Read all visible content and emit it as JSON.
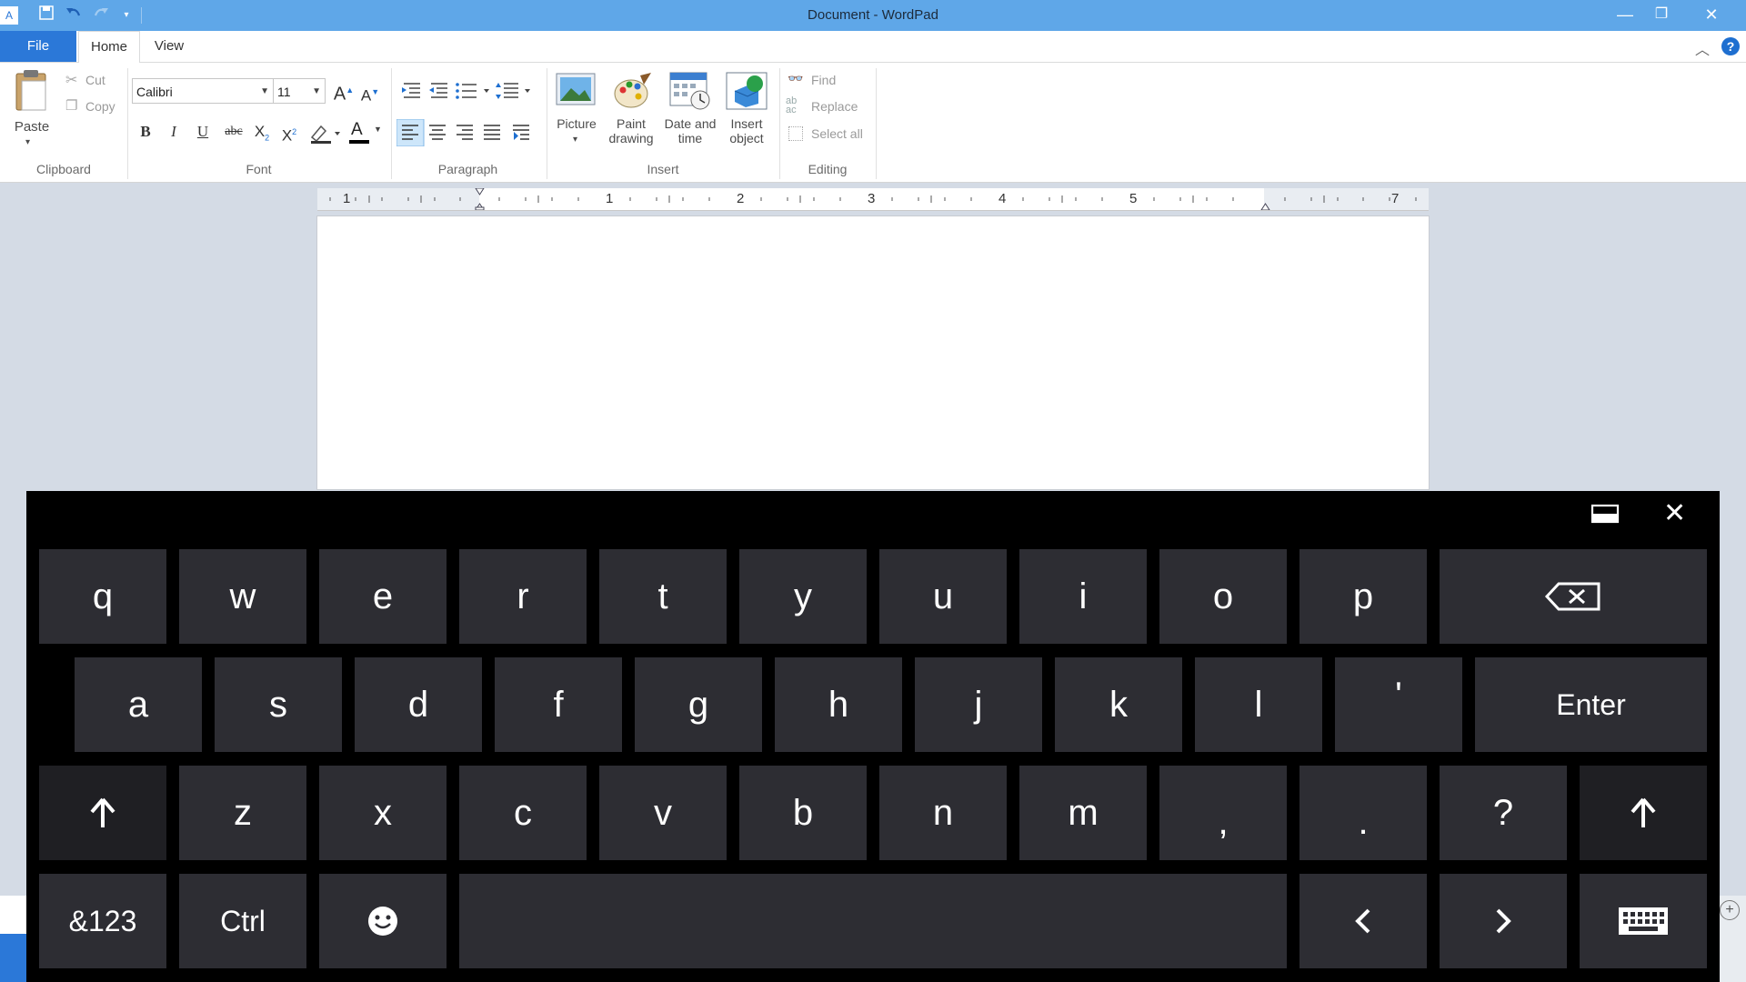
{
  "window": {
    "title": "Document - WordPad",
    "controls": {
      "minimize": "—",
      "restore": "❐",
      "close": "✕"
    }
  },
  "tabs": [
    "File",
    "Home",
    "View"
  ],
  "ribbon": {
    "clipboard": {
      "paste": "Paste",
      "cut": "Cut",
      "copy": "Copy",
      "label": "Clipboard"
    },
    "font": {
      "family": "Calibri",
      "size": "11",
      "grow": "A",
      "shrink": "A",
      "bold": "B",
      "italic": "I",
      "underline": "U",
      "strike": "abc",
      "subscript": "X",
      "superscript": "X",
      "color_letter": "A",
      "label": "Font"
    },
    "paragraph": {
      "label": "Paragraph"
    },
    "insert": {
      "picture": "Picture",
      "paint1": "Paint",
      "paint2": "drawing",
      "date1": "Date and",
      "date2": "time",
      "object1": "Insert",
      "object2": "object",
      "label": "Insert"
    },
    "editing": {
      "find": "Find",
      "replace": "Replace",
      "select_all": "Select all",
      "label": "Editing"
    }
  },
  "ruler": {
    "numbers": [
      "1",
      "1",
      "2",
      "3",
      "4",
      "5",
      "7"
    ]
  },
  "keyboard": {
    "row1": [
      "q",
      "w",
      "e",
      "r",
      "t",
      "y",
      "u",
      "i",
      "o",
      "p"
    ],
    "row2": [
      "a",
      "s",
      "d",
      "f",
      "g",
      "h",
      "j",
      "k",
      "l",
      "'"
    ],
    "enter": "Enter",
    "row3": [
      "z",
      "x",
      "c",
      "v",
      "b",
      "n",
      "m",
      ",",
      ".",
      "?"
    ],
    "symbols": "&123",
    "ctrl": "Ctrl",
    "emoji": "☺",
    "left": "‹",
    "right": "›",
    "shift": "🡅"
  },
  "colors": {
    "titlebar": "#5fa7e8",
    "file_tab": "#2b78d8",
    "key": "#2d2d33",
    "keyboard_bg": "#000000"
  }
}
